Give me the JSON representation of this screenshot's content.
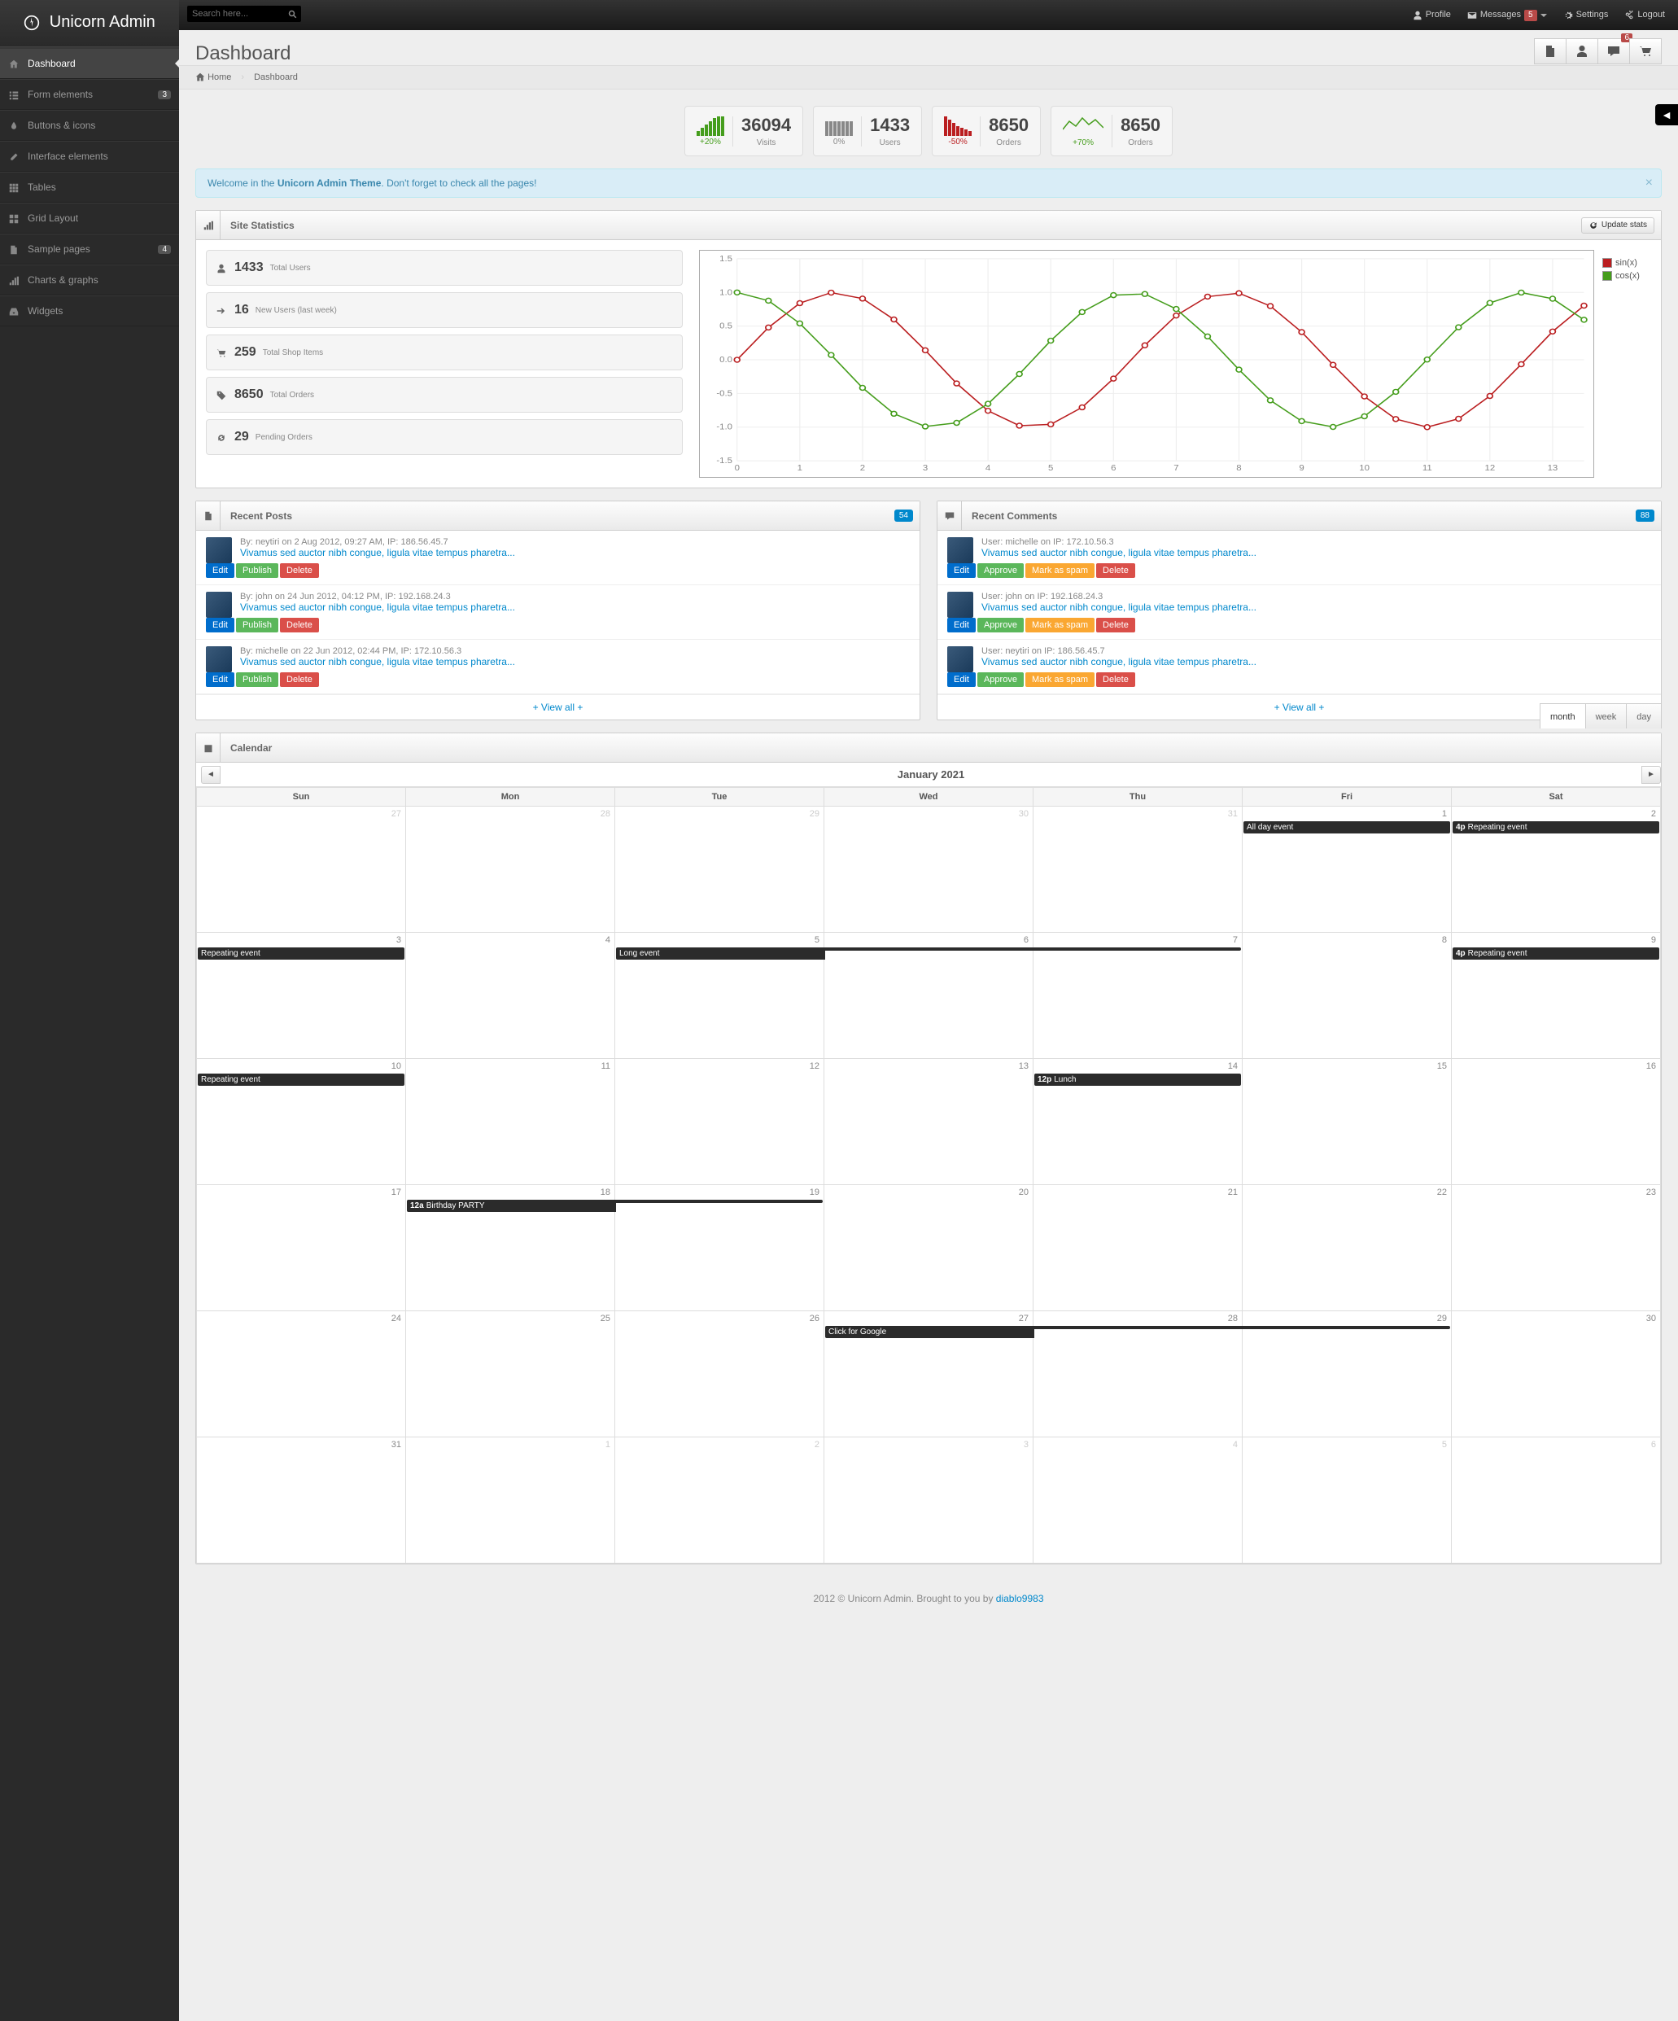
{
  "brand": "Unicorn Admin",
  "search": {
    "placeholder": "Search here..."
  },
  "userNav": {
    "profile": "Profile",
    "messages": "Messages",
    "messagesBadge": "5",
    "settings": "Settings",
    "logout": "Logout"
  },
  "sidebar": {
    "items": [
      {
        "label": "Dashboard",
        "icon": "home"
      },
      {
        "label": "Form elements",
        "icon": "list",
        "badge": "3"
      },
      {
        "label": "Buttons & icons",
        "icon": "tint"
      },
      {
        "label": "Interface elements",
        "icon": "pencil"
      },
      {
        "label": "Tables",
        "icon": "th"
      },
      {
        "label": "Grid Layout",
        "icon": "grid"
      },
      {
        "label": "Sample pages",
        "icon": "file",
        "badge": "4"
      },
      {
        "label": "Charts & graphs",
        "icon": "signal"
      },
      {
        "label": "Widgets",
        "icon": "inbox"
      }
    ]
  },
  "page": {
    "title": "Dashboard",
    "actionBadge": "6"
  },
  "breadcrumb": {
    "home": "Home",
    "current": "Dashboard"
  },
  "statBoxes": [
    {
      "pct": "+20%",
      "pctCls": "green",
      "value": "36094",
      "label": "Visits",
      "spark": "green",
      "bars": [
        6,
        10,
        14,
        18,
        22,
        24,
        24
      ]
    },
    {
      "pct": "0%",
      "pctCls": "gray",
      "value": "1433",
      "label": "Users",
      "spark": "gray",
      "bars": [
        18,
        18,
        18,
        18,
        18,
        18,
        18
      ]
    },
    {
      "pct": "-50%",
      "pctCls": "red",
      "value": "8650",
      "label": "Orders",
      "spark": "red",
      "bars": [
        24,
        20,
        16,
        12,
        10,
        8,
        6
      ]
    },
    {
      "pct": "+70%",
      "pctCls": "green",
      "value": "8650",
      "label": "Orders",
      "spark": "line"
    }
  ],
  "alert": {
    "pre": "Welcome in the ",
    "bold": "Unicorn Admin Theme",
    "post": ". Don't forget to check all the pages!"
  },
  "siteStats": {
    "title": "Site Statistics",
    "update": "Update stats",
    "rows": [
      {
        "ico": "user",
        "value": "1433",
        "label": "Total Users"
      },
      {
        "ico": "arrow",
        "value": "16",
        "label": "New Users (last week)"
      },
      {
        "ico": "cart",
        "value": "259",
        "label": "Total Shop Items"
      },
      {
        "ico": "tag",
        "value": "8650",
        "label": "Total Orders"
      },
      {
        "ico": "repeat",
        "value": "29",
        "label": "Pending Orders"
      }
    ]
  },
  "chart_data": {
    "type": "line",
    "title": "",
    "xlabel": "",
    "ylabel": "",
    "xlim": [
      0,
      13.5
    ],
    "ylim": [
      -1.5,
      1.5
    ],
    "x_ticks": [
      0,
      1,
      2,
      3,
      4,
      5,
      6,
      7,
      8,
      9,
      10,
      11,
      12,
      13
    ],
    "y_ticks": [
      -1.5,
      -1.0,
      -0.5,
      0.0,
      0.5,
      1.0,
      1.5
    ],
    "series": [
      {
        "name": "sin(x)",
        "color": "#ba1e20",
        "x": [
          0,
          0.5,
          1,
          1.5,
          2,
          2.5,
          3,
          3.5,
          4,
          4.5,
          5,
          5.5,
          6,
          6.5,
          7,
          7.5,
          8,
          8.5,
          9,
          9.5,
          10,
          10.5,
          11,
          11.5,
          12,
          12.5,
          13,
          13.5
        ],
        "y": [
          0,
          0.479,
          0.841,
          0.997,
          0.909,
          0.599,
          0.141,
          -0.351,
          -0.757,
          -0.978,
          -0.959,
          -0.706,
          -0.279,
          0.215,
          0.657,
          0.938,
          0.989,
          0.798,
          0.412,
          -0.075,
          -0.544,
          -0.88,
          -1.0,
          -0.876,
          -0.537,
          -0.066,
          0.42,
          0.804
        ]
      },
      {
        "name": "cos(x)",
        "color": "#459d1c",
        "x": [
          0,
          0.5,
          1,
          1.5,
          2,
          2.5,
          3,
          3.5,
          4,
          4.5,
          5,
          5.5,
          6,
          6.5,
          7,
          7.5,
          8,
          8.5,
          9,
          9.5,
          10,
          10.5,
          11,
          11.5,
          12,
          12.5,
          13,
          13.5
        ],
        "y": [
          1,
          0.878,
          0.54,
          0.071,
          -0.416,
          -0.801,
          -0.99,
          -0.936,
          -0.654,
          -0.211,
          0.284,
          0.709,
          0.96,
          0.977,
          0.754,
          0.347,
          -0.146,
          -0.602,
          -0.911,
          -0.997,
          -0.839,
          -0.476,
          0.004,
          0.483,
          0.844,
          0.998,
          0.907,
          0.594
        ]
      }
    ],
    "legend": [
      "sin(x)",
      "cos(x)"
    ]
  },
  "posts": {
    "title": "Recent Posts",
    "badge": "54",
    "items": [
      {
        "meta": "By: neytiri on 2 Aug 2012, 09:27 AM, IP: 186.56.45.7",
        "title": "Vivamus sed auctor nibh congue, ligula vitae tempus pharetra..."
      },
      {
        "meta": "By: john on 24 Jun 2012, 04:12 PM, IP: 192.168.24.3",
        "title": "Vivamus sed auctor nibh congue, ligula vitae tempus pharetra..."
      },
      {
        "meta": "By: michelle on 22 Jun 2012, 02:44 PM, IP: 172.10.56.3",
        "title": "Vivamus sed auctor nibh congue, ligula vitae tempus pharetra..."
      }
    ],
    "btns": {
      "edit": "Edit",
      "publish": "Publish",
      "delete": "Delete"
    },
    "viewAll": "+ View all +"
  },
  "comments": {
    "title": "Recent Comments",
    "badge": "88",
    "items": [
      {
        "meta": "User: michelle on IP: 172.10.56.3",
        "title": "Vivamus sed auctor nibh congue, ligula vitae tempus pharetra..."
      },
      {
        "meta": "User: john on IP: 192.168.24.3",
        "title": "Vivamus sed auctor nibh congue, ligula vitae tempus pharetra..."
      },
      {
        "meta": "User: neytiri on IP: 186.56.45.7",
        "title": "Vivamus sed auctor nibh congue, ligula vitae tempus pharetra..."
      }
    ],
    "btns": {
      "edit": "Edit",
      "approve": "Approve",
      "spam": "Mark as spam",
      "delete": "Delete"
    },
    "viewAll": "+ View all +"
  },
  "calendar": {
    "title": "Calendar",
    "month": "January 2021",
    "views": {
      "month": "month",
      "week": "week",
      "day": "day"
    },
    "days": [
      "Sun",
      "Mon",
      "Tue",
      "Wed",
      "Thu",
      "Fri",
      "Sat"
    ],
    "grid": [
      [
        {
          "n": "27",
          "o": 1
        },
        {
          "n": "28",
          "o": 1
        },
        {
          "n": "29",
          "o": 1
        },
        {
          "n": "30",
          "o": 1
        },
        {
          "n": "31",
          "o": 1
        },
        {
          "n": "1",
          "ev": [
            {
              "t": "All day event"
            }
          ]
        },
        {
          "n": "2",
          "ev": [
            {
              "tm": "4p",
              "t": "Repeating event"
            }
          ]
        }
      ],
      [
        {
          "n": "3",
          "ev": [
            {
              "t": "Repeating event"
            }
          ]
        },
        {
          "n": "4"
        },
        {
          "n": "5",
          "ev": [
            {
              "t": "Long event",
              "multi": "start"
            }
          ]
        },
        {
          "n": "6",
          "ev": [
            {
              "t": " ",
              "multi": "mid"
            }
          ]
        },
        {
          "n": "7",
          "ev": [
            {
              "t": " ",
              "multi": "end"
            }
          ]
        },
        {
          "n": "8"
        },
        {
          "n": "9",
          "ev": [
            {
              "tm": "4p",
              "t": "Repeating event"
            }
          ]
        }
      ],
      [
        {
          "n": "10",
          "ev": [
            {
              "t": "Repeating event"
            }
          ]
        },
        {
          "n": "11"
        },
        {
          "n": "12"
        },
        {
          "n": "13"
        },
        {
          "n": "14",
          "ev": [
            {
              "tm": "12p",
              "t": "Lunch"
            }
          ]
        },
        {
          "n": "15"
        },
        {
          "n": "16"
        }
      ],
      [
        {
          "n": "17"
        },
        {
          "n": "18",
          "ev": [
            {
              "tm": "12a",
              "t": "Birthday PARTY",
              "multi": "start"
            }
          ]
        },
        {
          "n": "19",
          "ev": [
            {
              "t": " ",
              "multi": "end"
            }
          ]
        },
        {
          "n": "20"
        },
        {
          "n": "21"
        },
        {
          "n": "22"
        },
        {
          "n": "23"
        }
      ],
      [
        {
          "n": "24"
        },
        {
          "n": "25"
        },
        {
          "n": "26"
        },
        {
          "n": "27",
          "ev": [
            {
              "t": "Click for Google",
              "multi": "start"
            }
          ]
        },
        {
          "n": "28",
          "ev": [
            {
              "t": " ",
              "multi": "mid"
            }
          ]
        },
        {
          "n": "29",
          "ev": [
            {
              "t": " ",
              "multi": "end"
            }
          ]
        },
        {
          "n": "30"
        }
      ],
      [
        {
          "n": "31"
        },
        {
          "n": "1",
          "o": 1
        },
        {
          "n": "2",
          "o": 1
        },
        {
          "n": "3",
          "o": 1
        },
        {
          "n": "4",
          "o": 1
        },
        {
          "n": "5",
          "o": 1
        },
        {
          "n": "6",
          "o": 1
        }
      ]
    ]
  },
  "footer": {
    "text": "2012 © Unicorn Admin. Brought to you by ",
    "link": "diablo9983"
  }
}
